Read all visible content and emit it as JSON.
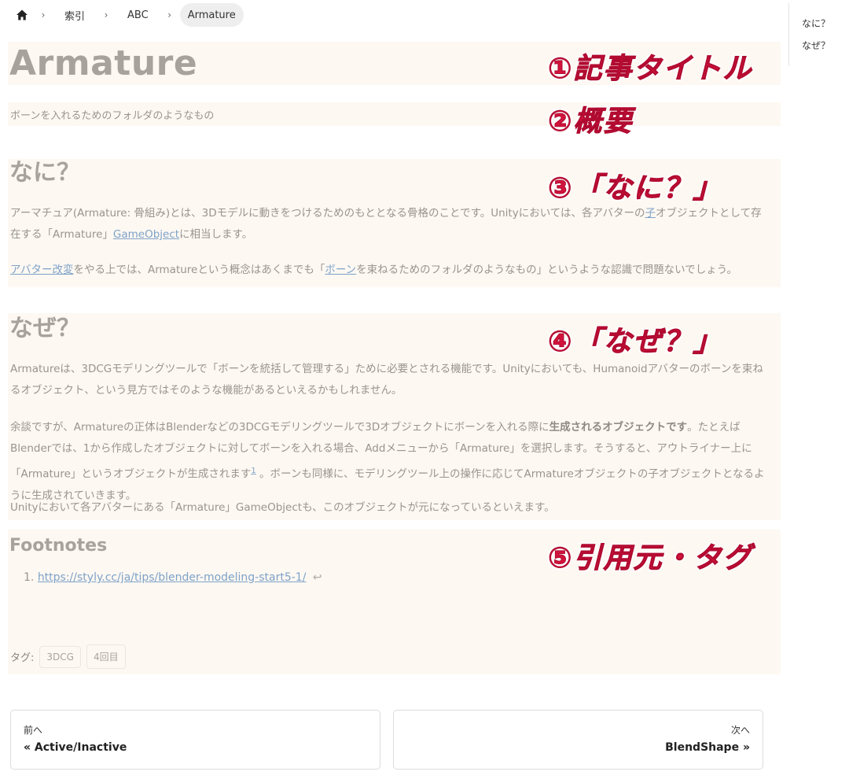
{
  "breadcrumb": {
    "items": [
      "索引",
      "ABC",
      "Armature"
    ]
  },
  "toc": {
    "items": [
      "なに？",
      "なぜ？"
    ]
  },
  "article": {
    "title": "Armature",
    "summary": "ボーンを入れるためのフォルダのようなもの",
    "what": {
      "heading": "なに？",
      "p1_a": "アーマチュア(Armature: 骨組み)とは、3Dモデルに動きをつけるためのもととなる骨格のことです。Unityにおいては、各アバターの",
      "p1_link1": "子",
      "p1_b": "オブジェクトとして存在する「Armature」",
      "p1_link2": "GameObject",
      "p1_c": "に相当します。",
      "p2_link1": "アバター改変",
      "p2_a": "をやる上では、Armatureという概念はあくまでも「",
      "p2_link2": "ボーン",
      "p2_b": "を束ねるためのフォルダのようなもの」というような認識で問題ないでしょう。"
    },
    "why": {
      "heading": "なぜ？",
      "p3": "Armatureは、3DCGモデリングツールで「ボーンを統括して管理する」ために必要とされる機能です。Unityにおいても、Humanoidアバターのボーンを束ねるオブジェクト、という見方ではそのような機能があるといえるかもしれません。",
      "p4_a": "余談ですが、Armatureの正体はBlenderなどの3DCGモデリングツールで3Dオブジェクトにボーンを入れる際に",
      "p4_bold": "生成されるオブジェクトです",
      "p4_b": "。たとえばBlenderでは、1から作成したオブジェクトに対してボーンを入れる場合、Addメニューから「Armature」を選択します。そうすると、アウトライナー上に「Armature」というオブジェクトが生成されます",
      "p4_sup": "1",
      "p4_c": " 。ボーンも同様に、モデリングツール上の操作に応じてArmatureオブジェクトの子オブジェクトとなるように生成されていきます。",
      "p5": "Unityにおいて各アバターにある「Armature」GameObjectも、このオブジェクトが元になっているといえます。"
    },
    "footnotes": {
      "heading": "Footnotes",
      "items": [
        {
          "number": "1.",
          "url": "https://styly.cc/ja/tips/blender-modeling-start5-1/",
          "back": "↩"
        }
      ]
    },
    "tags": {
      "label": "タグ:",
      "items": [
        "3DCG",
        "4回目"
      ]
    }
  },
  "annotations": {
    "a1": "①記事タイトル",
    "a2": "②概要",
    "a3": "③「なに？」",
    "a4": "④「なぜ？」",
    "a5": "⑤引用元・タグ"
  },
  "pager": {
    "prev_label": "前へ",
    "prev_title": "« Active/Inactive",
    "next_label": "次へ",
    "next_title": "BlendShape »"
  },
  "colors": {
    "highlight_bg": "#fdf8f2",
    "annotation": "#d2143c",
    "link": "#7ea2c8"
  }
}
